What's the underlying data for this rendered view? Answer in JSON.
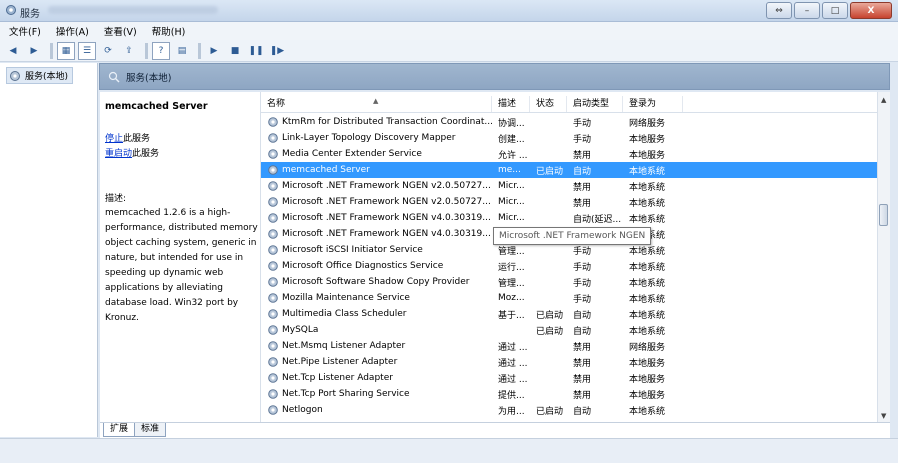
{
  "window": {
    "title": "服务",
    "buttons": {
      "minimize": "–",
      "maximize": "□",
      "close": "X"
    }
  },
  "menu": [
    "文件(F)",
    "操作(A)",
    "查看(V)",
    "帮助(H)"
  ],
  "tree": {
    "node_label": "服务(本地)"
  },
  "header": {
    "title": "服务(本地)"
  },
  "details": {
    "service_title": "memcached Server",
    "stop_link": "停止",
    "stop_suffix": "此服务",
    "restart_link": "重启动",
    "restart_suffix": "此服务",
    "desc_label": "描述:",
    "desc_text": "memcached 1.2.6 is a high-performance, distributed memory object caching system, generic in nature, but intended for use in speeding up dynamic web applications by alleviating database load. Win32 port by Kronuz."
  },
  "columns": {
    "name": "名称",
    "desc": "描述",
    "status": "状态",
    "startup": "启动类型",
    "logon": "登录为"
  },
  "services": [
    {
      "name": "KtmRm for Distributed Transaction Coordinat...",
      "desc": "协调...",
      "status": "",
      "startup": "手动",
      "logon": "网络服务"
    },
    {
      "name": "Link-Layer Topology Discovery Mapper",
      "desc": "创建...",
      "status": "",
      "startup": "手动",
      "logon": "本地服务"
    },
    {
      "name": "Media Center Extender Service",
      "desc": "允许 ...",
      "status": "",
      "startup": "禁用",
      "logon": "本地服务"
    },
    {
      "name": "memcached Server",
      "desc": "me...",
      "status": "已启动",
      "startup": "自动",
      "logon": "本地系统",
      "selected": true
    },
    {
      "name": "Microsoft .NET Framework NGEN v2.0.50727...",
      "desc": "Micr...",
      "status": "",
      "startup": "禁用",
      "logon": "本地系统"
    },
    {
      "name": "Microsoft .NET Framework NGEN v2.0.50727...",
      "desc": "Micr...",
      "status": "",
      "startup": "禁用",
      "logon": "本地系统"
    },
    {
      "name": "Microsoft .NET Framework NGEN v4.0.30319...",
      "desc": "Micr...",
      "status": "",
      "startup": "自动(延迟...",
      "logon": "本地系统"
    },
    {
      "name": "Microsoft .NET Framework NGEN v4.0.30319...",
      "desc": "",
      "status": "",
      "startup": "",
      "logon": "本地系统"
    },
    {
      "name": "Microsoft iSCSI Initiator Service",
      "desc": "管理...",
      "status": "",
      "startup": "手动",
      "logon": "本地系统"
    },
    {
      "name": "Microsoft Office Diagnostics Service",
      "desc": "运行...",
      "status": "",
      "startup": "手动",
      "logon": "本地系统"
    },
    {
      "name": "Microsoft Software Shadow Copy Provider",
      "desc": "管理...",
      "status": "",
      "startup": "手动",
      "logon": "本地系统"
    },
    {
      "name": "Mozilla Maintenance Service",
      "desc": "Moz...",
      "status": "",
      "startup": "手动",
      "logon": "本地系统"
    },
    {
      "name": "Multimedia Class Scheduler",
      "desc": "基于...",
      "status": "已启动",
      "startup": "自动",
      "logon": "本地系统"
    },
    {
      "name": "MySQLa",
      "desc": "",
      "status": "已启动",
      "startup": "自动",
      "logon": "本地系统"
    },
    {
      "name": "Net.Msmq Listener Adapter",
      "desc": "通过 ...",
      "status": "",
      "startup": "禁用",
      "logon": "网络服务"
    },
    {
      "name": "Net.Pipe Listener Adapter",
      "desc": "通过 ...",
      "status": "",
      "startup": "禁用",
      "logon": "本地服务"
    },
    {
      "name": "Net.Tcp Listener Adapter",
      "desc": "通过 ...",
      "status": "",
      "startup": "禁用",
      "logon": "本地服务"
    },
    {
      "name": "Net.Tcp Port Sharing Service",
      "desc": "提供...",
      "status": "",
      "startup": "禁用",
      "logon": "本地服务"
    },
    {
      "name": "Netlogon",
      "desc": "为用...",
      "status": "已启动",
      "startup": "自动",
      "logon": "本地系统"
    }
  ],
  "tooltip": {
    "text": "Microsoft .NET Framework NGEN"
  },
  "tabs": [
    "扩展",
    "标准"
  ],
  "colors": {
    "selection": "#3399ff",
    "link": "#0033cc",
    "header_band": "#98afca"
  }
}
